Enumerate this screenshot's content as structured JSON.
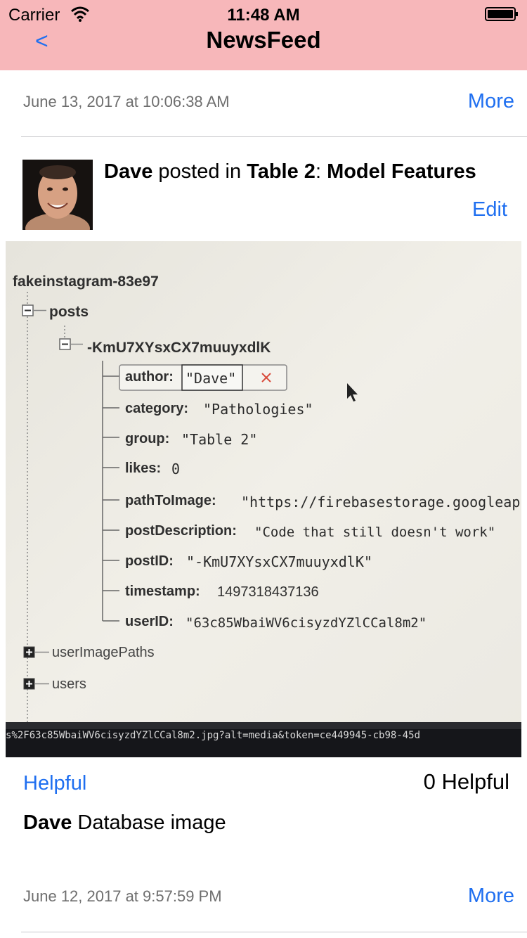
{
  "status": {
    "carrier": "Carrier",
    "time": "11:48 AM"
  },
  "nav": {
    "back": "<",
    "title": "NewsFeed"
  },
  "posts": [
    {
      "date": "June 13, 2017 at 10:06:38 AM",
      "more": "More"
    },
    {
      "date": "June 12, 2017 at 9:57:59 PM",
      "more": "More"
    }
  ],
  "post": {
    "author": "Dave",
    "posted_in": "posted in",
    "group": "Table 2",
    "colon": ":",
    "title": "Model Features",
    "edit": "Edit",
    "helpful_button": "Helpful",
    "helpful_count": "0 Helpful",
    "caption_author": "Dave",
    "caption_text": "Database image"
  },
  "photo": {
    "root": "fakeinstagram-83e97",
    "posts_node": "posts",
    "post_id_node": "-KmU7XYsxCX7muuyxdlK",
    "fields": [
      {
        "key": "author:",
        "value": "\"Dave\""
      },
      {
        "key": "category:",
        "value": "\"Pathologies\""
      },
      {
        "key": "group:",
        "value": "\"Table 2\""
      },
      {
        "key": "likes:",
        "value": "0"
      },
      {
        "key": "pathToImage:",
        "value": "\"https://firebasestorage.googleap"
      },
      {
        "key": "postDescription:",
        "value": "\"Code that still doesn't work\""
      },
      {
        "key": "postID:",
        "value": "\"-KmU7XYsxCX7muuyxdlK\""
      },
      {
        "key": "timestamp:",
        "value": "1497318437136"
      },
      {
        "key": "userID:",
        "value": "\"63c85WbaiWV6cisyzdYZlCCal8m2\""
      }
    ],
    "user_image_paths": "userImagePaths",
    "users": "users",
    "footer_url": "s%2F63c85WbaiWV6cisyzdYZlCCal8m2.jpg?alt=media&token=ce449945-cb98-45d"
  }
}
